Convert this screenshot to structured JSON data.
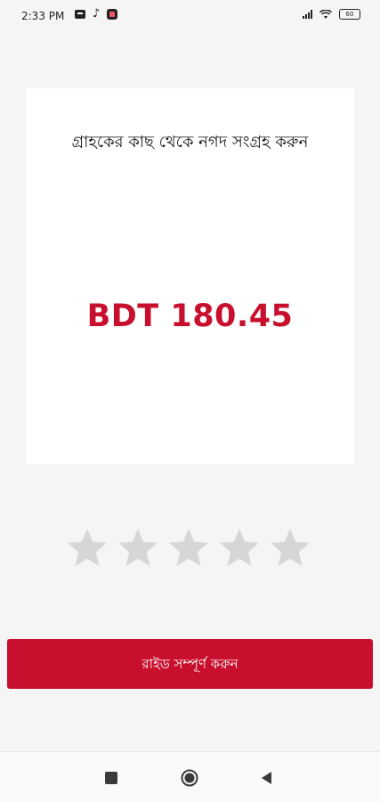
{
  "status_bar": {
    "time": "2:33 PM",
    "battery": "60",
    "icons_left": [
      "message-icon",
      "tiktok-icon",
      "app-icon"
    ],
    "icons_right": [
      "signal-icon",
      "wifi-icon",
      "battery-icon"
    ]
  },
  "card": {
    "title": "গ্রাহকের কাছ থেকে নগদ সংগ্রহ করুন",
    "amount": "BDT 180.45"
  },
  "rating": {
    "max_stars": 5,
    "selected": 0,
    "star_color_empty": "#d6d6d6"
  },
  "complete_button": {
    "label": "রাইড সম্পূর্ণ করুন"
  },
  "colors": {
    "accent": "#c8102e",
    "background": "#f5f5f5",
    "card": "#ffffff"
  },
  "nav_bar": {
    "buttons": [
      "recent-apps-button",
      "home-button",
      "back-button"
    ]
  }
}
